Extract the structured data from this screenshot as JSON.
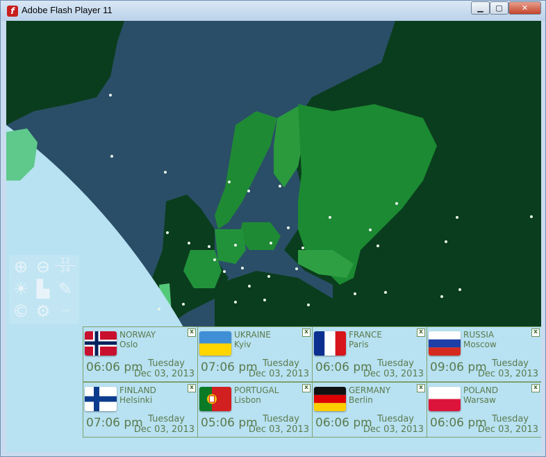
{
  "window": {
    "title": "Adobe Flash Player 11",
    "controls": {
      "minimize": "▁",
      "maximize": "▢",
      "close": "✕"
    },
    "app_icon": "f"
  },
  "toolbox": {
    "zoom_in_icon": "⊕",
    "zoom_out_icon": "⊖",
    "hour_format": {
      "top": "12",
      "bottom": "24"
    },
    "sun_icon": "☀",
    "city_icon": "▙",
    "brush_icon": "✎",
    "copyright_icon": "©",
    "settings_icon": "⚙",
    "arrows_icon": "‹››"
  },
  "clocks": [
    {
      "country": "NORWAY",
      "city": "Oslo",
      "time": "06:06 pm",
      "day": "Tuesday",
      "date": "Dec 03, 2013",
      "flag": "norway"
    },
    {
      "country": "UKRAINE",
      "city": "Kyiv",
      "time": "07:06 pm",
      "day": "Tuesday",
      "date": "Dec 03, 2013",
      "flag": "ukraine"
    },
    {
      "country": "FRANCE",
      "city": "Paris",
      "time": "06:06 pm",
      "day": "Tuesday",
      "date": "Dec 03, 2013",
      "flag": "france"
    },
    {
      "country": "RUSSIA",
      "city": "Moscow",
      "time": "09:06 pm",
      "day": "Tuesday",
      "date": "Dec 03, 2013",
      "flag": "russia"
    },
    {
      "country": "FINLAND",
      "city": "Helsinki",
      "time": "07:06 pm",
      "day": "Tuesday",
      "date": "Dec 03, 2013",
      "flag": "finland"
    },
    {
      "country": "PORTUGAL",
      "city": "Lisbon",
      "time": "05:06 pm",
      "day": "Tuesday",
      "date": "Dec 03, 2013",
      "flag": "portugal"
    },
    {
      "country": "GERMANY",
      "city": "Berlin",
      "time": "06:06 pm",
      "day": "Tuesday",
      "date": "Dec 03, 2013",
      "flag": "germany"
    },
    {
      "country": "POLAND",
      "city": "Warsaw",
      "time": "06:06 pm",
      "day": "Tuesday",
      "date": "Dec 03, 2013",
      "flag": "poland"
    }
  ],
  "clock_close_label": "x",
  "colors": {
    "sea": "#2a4e67",
    "land_dark": "#0a3d1d",
    "land_highlight": "#1f8a34",
    "daylight": "#b8e2f2",
    "panel_text": "#5b7a4d"
  }
}
